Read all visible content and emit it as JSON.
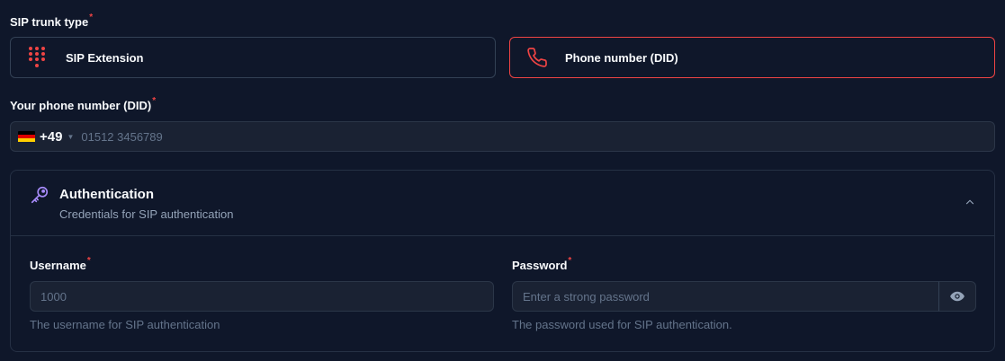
{
  "trunk_type": {
    "label": "SIP trunk type",
    "required_mark": "*",
    "options": [
      {
        "label": "SIP Extension",
        "icon": "dialpad-icon",
        "selected": false
      },
      {
        "label": "Phone number (DID)",
        "icon": "phone-icon",
        "selected": true
      }
    ]
  },
  "phone": {
    "label": "Your phone number (DID)",
    "required_mark": "*",
    "country_flag": "de-flag-icon",
    "dial_code": "+49",
    "value": "",
    "placeholder": "01512 3456789"
  },
  "auth": {
    "title": "Authentication",
    "subtitle": "Credentials for SIP authentication",
    "icon": "key-icon",
    "username": {
      "label": "Username",
      "required_mark": "*",
      "value": "",
      "placeholder": "1000",
      "help": "The username for SIP authentication"
    },
    "password": {
      "label": "Password",
      "required_mark": "*",
      "value": "",
      "placeholder": "Enter a strong password",
      "help": "The password used for SIP authentication."
    }
  },
  "colors": {
    "background": "#0f172a",
    "accent": "#ef4444",
    "key_icon": "#a78bfa",
    "input_bg": "#1a2233"
  }
}
